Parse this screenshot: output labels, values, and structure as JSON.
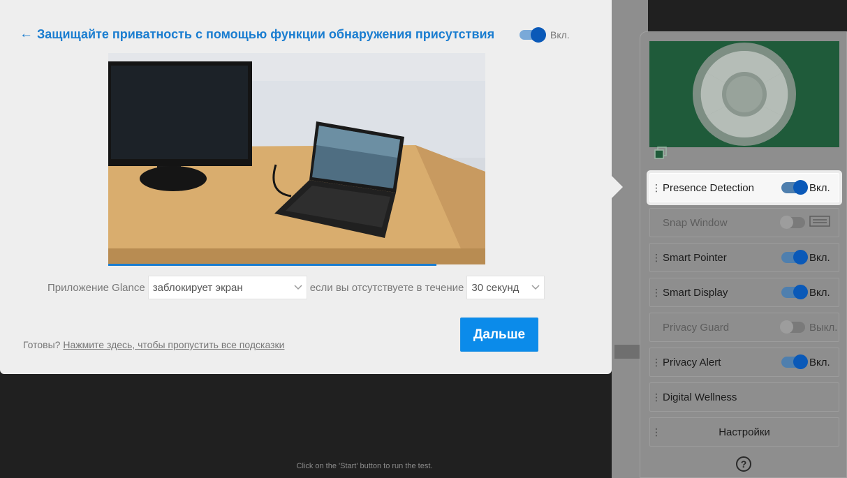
{
  "dialog": {
    "title": "Защищайте приватность с помощью функции обнаружения присутствия",
    "toggle_state": "Вкл.",
    "sentence": {
      "prefix": "Приложение Glance",
      "action_select": "заблокирует экран",
      "middle": "если вы отсутствуете в течение",
      "time_select": "30 секунд"
    },
    "ready_text": "Готовы?",
    "skip_link": "Нажмите здесь, чтобы пропустить все подсказки",
    "next_button": "Дальше",
    "video_progress": 0.87
  },
  "panel": {
    "items": [
      {
        "label": "Presence Detection",
        "state": "Вкл.",
        "toggle": "on",
        "active": true
      },
      {
        "label": "Snap Window",
        "state": "",
        "toggle": "off",
        "disabled": true
      },
      {
        "label": "Smart Pointer",
        "state": "Вкл.",
        "toggle": "on"
      },
      {
        "label": "Smart Display",
        "state": "Вкл.",
        "toggle": "on"
      },
      {
        "label": "Privacy Guard",
        "state": "Выкл.",
        "toggle": "off",
        "disabled": true
      },
      {
        "label": "Privacy Alert",
        "state": "Вкл.",
        "toggle": "on"
      },
      {
        "label": "Digital Wellness",
        "state": "",
        "toggle": "none"
      },
      {
        "label": "Настройки",
        "state": "",
        "toggle": "none"
      }
    ],
    "help": "?"
  },
  "footer": {
    "text": "Click on the 'Start' button to run the test."
  },
  "colors": {
    "accent": "#1a7dd0",
    "button": "#0b8bea",
    "toggle_on": "#0a59b8",
    "preview_bg": "#1f5b3a"
  }
}
